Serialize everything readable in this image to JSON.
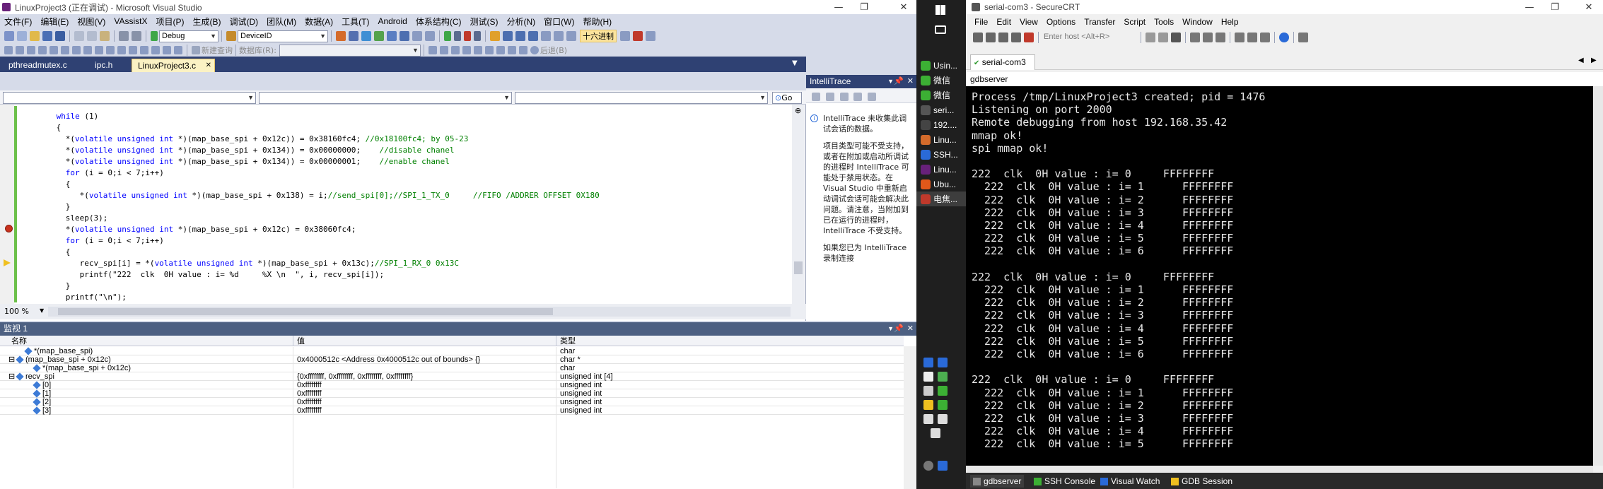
{
  "vs": {
    "title": "LinuxProject3 (正在调试) - Microsoft Visual Studio",
    "menu": [
      "文件(F)",
      "编辑(E)",
      "视图(V)",
      "VAssistX",
      "项目(P)",
      "生成(B)",
      "调试(D)",
      "团队(M)",
      "数据(A)",
      "工具(T)",
      "Android",
      "体系结构(C)",
      "测试(S)",
      "分析(N)",
      "窗口(W)",
      "帮助(H)"
    ],
    "toolbar": {
      "config": "Debug",
      "device": "DeviceID",
      "hex_label": "十六进制"
    },
    "toolbar2": {
      "new_query": "新建查询",
      "database": "数据库(R):",
      "back": "后退(B)"
    },
    "tabs": [
      {
        "label": "pthreadmutex.c",
        "active": false
      },
      {
        "label": "ipc.h",
        "active": false
      },
      {
        "label": "LinuxProject3.c",
        "active": true
      }
    ],
    "go_label": "Go",
    "zoom": "100 %",
    "code": [
      {
        "parts": [
          [
            "kw",
            "while"
          ],
          [
            "n",
            " (1)"
          ]
        ],
        "indent": 6
      },
      {
        "parts": [
          [
            "n",
            "{"
          ]
        ],
        "indent": 6
      },
      {
        "parts": [
          [
            "n",
            "*("
          ],
          [
            "kw",
            "volatile unsigned int"
          ],
          [
            "n",
            " *)(map_base_spi + 0x12c)) = 0x38160fc4; "
          ],
          [
            "cm",
            "//0x18100fc4; by 05-23"
          ]
        ],
        "indent": 8
      },
      {
        "parts": [
          [
            "n",
            "*("
          ],
          [
            "kw",
            "volatile unsigned int"
          ],
          [
            "n",
            " *)(map_base_spi + 0x134)) = 0x00000000;    "
          ],
          [
            "cm",
            "//disable chanel"
          ]
        ],
        "indent": 8
      },
      {
        "parts": [
          [
            "n",
            "*("
          ],
          [
            "kw",
            "volatile unsigned int"
          ],
          [
            "n",
            " *)(map_base_spi + 0x134)) = 0x00000001;    "
          ],
          [
            "cm",
            "//enable chanel"
          ]
        ],
        "indent": 8
      },
      {
        "parts": [
          [
            "kw",
            "for"
          ],
          [
            "n",
            " (i = 0;i < 7;i++)"
          ]
        ],
        "indent": 8
      },
      {
        "parts": [
          [
            "n",
            "{"
          ]
        ],
        "indent": 8
      },
      {
        "parts": [
          [
            "n",
            "*("
          ],
          [
            "kw",
            "volatile unsigned int"
          ],
          [
            "n",
            " *)(map_base_spi + 0x138) = i;"
          ],
          [
            "cm",
            "//send_spi[0];//SPI_1_TX_0     //FIFO /ADDRER OFFSET 0X180"
          ]
        ],
        "indent": 11
      },
      {
        "parts": [
          [
            "n",
            "}"
          ]
        ],
        "indent": 8
      },
      {
        "parts": [
          [
            "n",
            "sleep(3);"
          ]
        ],
        "indent": 8
      },
      {
        "parts": [
          [
            "n",
            "*("
          ],
          [
            "kw",
            "volatile unsigned int"
          ],
          [
            "n",
            " *)(map_base_spi + 0x12c) = 0x38060fc4;"
          ]
        ],
        "indent": 8
      },
      {
        "parts": [
          [
            "kw",
            "for"
          ],
          [
            "n",
            " (i = 0;i < 7;i++)"
          ]
        ],
        "indent": 8
      },
      {
        "parts": [
          [
            "n",
            "{"
          ]
        ],
        "indent": 8
      },
      {
        "parts": [
          [
            "n",
            "recv_spi[i] = *("
          ],
          [
            "kw",
            "volatile unsigned int"
          ],
          [
            "n",
            " *)(map_base_spi + 0x13c);"
          ],
          [
            "cm",
            "//SPI_1_RX_0 0x13C"
          ]
        ],
        "indent": 11
      },
      {
        "parts": [
          [
            "n",
            "printf(\"222  clk  0H value : i= %d     %X \\n  \", i, recv_spi[i]);"
          ]
        ],
        "indent": 11
      },
      {
        "parts": [
          [
            "n",
            "}"
          ]
        ],
        "indent": 8
      },
      {
        "parts": [
          [
            "n",
            "printf(\"\\n\");"
          ]
        ],
        "indent": 8
      }
    ],
    "intellitrace": {
      "title": "IntelliTrace",
      "note1": "IntelliTrace 未收集此调试会话的数据。",
      "note2": "项目类型可能不受支持，或者在附加或启动所调试的进程时 IntelliTrace 可能处于禁用状态。在 Visual Studio 中重新启动调试会话可能会解决此问题。请注意，当附加到已在运行的进程时，IntelliTrace 不受支持。",
      "note3": "如果您已为 IntelliTrace 录制连接"
    },
    "watch": {
      "title": "监视 1",
      "headers": [
        "名称",
        "值",
        "类型"
      ],
      "rows": [
        {
          "name": "*(map_base_spi)",
          "value": "",
          "type": "char",
          "level": 1,
          "expand": ""
        },
        {
          "name": "(map_base_spi + 0x12c)",
          "value": "0x4000512c <Address 0x4000512c out of bounds> {}",
          "type": "char *",
          "level": 0,
          "expand": "⊟"
        },
        {
          "name": "*(map_base_spi + 0x12c)",
          "value": "",
          "type": "char",
          "level": 2,
          "expand": ""
        },
        {
          "name": "recv_spi",
          "value": "{0xffffffff, 0xffffffff, 0xffffffff, 0xffffffff}",
          "type": "unsigned int [4]",
          "level": 0,
          "expand": "⊟"
        },
        {
          "name": "[0]",
          "value": "0xffffffff",
          "type": "unsigned int",
          "level": 2,
          "expand": ""
        },
        {
          "name": "[1]",
          "value": "0xffffffff",
          "type": "unsigned int",
          "level": 2,
          "expand": ""
        },
        {
          "name": "[2]",
          "value": "0xffffffff",
          "type": "unsigned int",
          "level": 2,
          "expand": ""
        },
        {
          "name": "[3]",
          "value": "0xffffffff",
          "type": "unsigned int",
          "level": 2,
          "expand": ""
        }
      ]
    }
  },
  "taskbar": {
    "items": [
      "Usin...",
      "微信",
      "微信",
      "seri...",
      "192....",
      "Linu...",
      "SSH...",
      "Linu...",
      "Ubu...",
      "电焦..."
    ]
  },
  "crt": {
    "title": "serial-com3 - SecureCRT",
    "menu": [
      "File",
      "Edit",
      "View",
      "Options",
      "Transfer",
      "Script",
      "Tools",
      "Window",
      "Help"
    ],
    "host_placeholder": "Enter host <Alt+R>",
    "tab": "serial-com3",
    "tab_close": "✕",
    "subtitle": "gdbserver",
    "lines": [
      "Process /tmp/LinuxProject3 created; pid = 1476",
      "Listening on port 2000",
      "Remote debugging from host 192.168.35.42",
      "mmap ok!",
      "spi mmap ok!",
      "",
      "222  clk  0H value : i= 0     FFFFFFFF",
      "  222  clk  0H value : i= 1      FFFFFFFF",
      "  222  clk  0H value : i= 2      FFFFFFFF",
      "  222  clk  0H value : i= 3      FFFFFFFF",
      "  222  clk  0H value : i= 4      FFFFFFFF",
      "  222  clk  0H value : i= 5      FFFFFFFF",
      "  222  clk  0H value : i= 6      FFFFFFFF",
      "",
      "222  clk  0H value : i= 0     FFFFFFFF",
      "  222  clk  0H value : i= 1      FFFFFFFF",
      "  222  clk  0H value : i= 2      FFFFFFFF",
      "  222  clk  0H value : i= 3      FFFFFFFF",
      "  222  clk  0H value : i= 4      FFFFFFFF",
      "  222  clk  0H value : i= 5      FFFFFFFF",
      "  222  clk  0H value : i= 6      FFFFFFFF",
      "",
      "222  clk  0H value : i= 0     FFFFFFFF",
      "  222  clk  0H value : i= 1      FFFFFFFF",
      "  222  clk  0H value : i= 2      FFFFFFFF",
      "  222  clk  0H value : i= 3      FFFFFFFF",
      "  222  clk  0H value : i= 4      FFFFFFFF",
      "  222  clk  0H value : i= 5      FFFFFFFF"
    ],
    "bottom_tabs": [
      "gdbserver",
      "SSH Console",
      "Visual Watch",
      "GDB Session"
    ]
  },
  "colors": {
    "vs_bg": "#d6dbe9",
    "vs_tab_bg": "#2f4173",
    "active_tab": "#fbf2c4",
    "panel_title": "#4d6082",
    "terminal_bg": "#000000",
    "terminal_fg": "#e8e8e8",
    "keyword": "#0000ff",
    "comment": "#008000"
  }
}
